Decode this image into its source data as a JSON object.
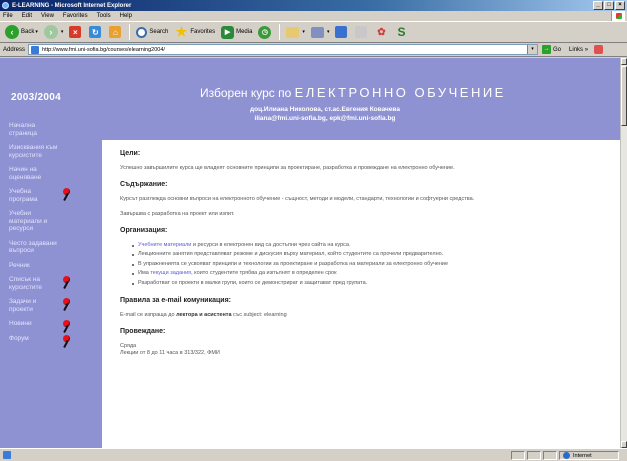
{
  "window": {
    "title": "E-LEARNING - Microsoft Internet Explorer",
    "controls": [
      "_",
      "□",
      "×"
    ]
  },
  "menu": [
    "File",
    "Edit",
    "View",
    "Favorites",
    "Tools",
    "Help"
  ],
  "toolbar": {
    "back": "Back",
    "search": "Search",
    "favorites": "Favorites",
    "media": "Media"
  },
  "address": {
    "label": "Address",
    "url": "http://www.fmi.uni-sofia.bg/courses/elearning2004/",
    "go": "Go",
    "links": "Links"
  },
  "page": {
    "year": "2003/2004",
    "title_prefix": "Изборен курс по",
    "title_main": "ЕЛЕКТРОННО ОБУЧЕНИЕ",
    "authors_line1": "доц.Илиана Николова, ст.ас.Евгения Ковачева",
    "authors_line2": "iliana@fmi.uni-sofia.bg, epk@fmi.uni-sofia.bg",
    "nav": [
      {
        "label": "Начална страница",
        "pin": false
      },
      {
        "label": "Изисквания към курсистите",
        "pin": false
      },
      {
        "label": "Начин на оценяване",
        "pin": false
      },
      {
        "label": "Учебна програма",
        "pin": true
      },
      {
        "label": "Учебни материали и ресурси",
        "pin": false
      },
      {
        "label": "Често задавани въпроси",
        "pin": false
      },
      {
        "label": "Речник",
        "pin": false
      },
      {
        "label": "Списък на курсистите",
        "pin": true
      },
      {
        "label": "Задачи и проекти",
        "pin": true
      },
      {
        "label": "Новини",
        "pin": true
      },
      {
        "label": "Форум",
        "pin": true
      }
    ],
    "goals_title": "Цели:",
    "goals_text": "Успешно завършилите курса ще владеят основните принципи за проектиране, разработка и провеждане на електронно обучение.",
    "content_title": "Съдържание:",
    "content_text1": "Курсът разглежда основни въпроси на електронното обучение - същност, методи и модели, стандарти, технологии и софтуерни средства.",
    "content_text2": "Завършва с разработка на проект или изпит.",
    "org_title": "Организация:",
    "org_items": [
      {
        "pre": "",
        "link": "Учебните материали",
        "post": " и ресурси в електронен вид са достъпни чрез сайта на курса."
      },
      {
        "pre": "Лекционните занятия представляват резюме и дискусия върху материал, който студентите са прочели предварително.",
        "link": "",
        "post": ""
      },
      {
        "pre": "В упражненията се усвояват принципи и технологии за проектиране и разработка на материали за електронно обучение",
        "link": "",
        "post": ""
      },
      {
        "pre": "Има ",
        "link": "текущи задания",
        "post": ", които студентите трябва да изпълнят в определен срок"
      },
      {
        "pre": "Разработват се проекти в малки групи, които се демонстрират и защитават пред групата.",
        "link": "",
        "post": ""
      }
    ],
    "email_title": "Правила за e-mail комуникация:",
    "email_pre": "E-mail се изпраща до ",
    "email_bold": "лектора и асистента",
    "email_post": " със subject: elearning",
    "schedule_title": "Провеждане:",
    "schedule_day": "Сряда",
    "schedule_time": "Лекции от 8 до 11 часа в 313/322, ФМИ"
  },
  "status": {
    "zone": "Internet"
  }
}
